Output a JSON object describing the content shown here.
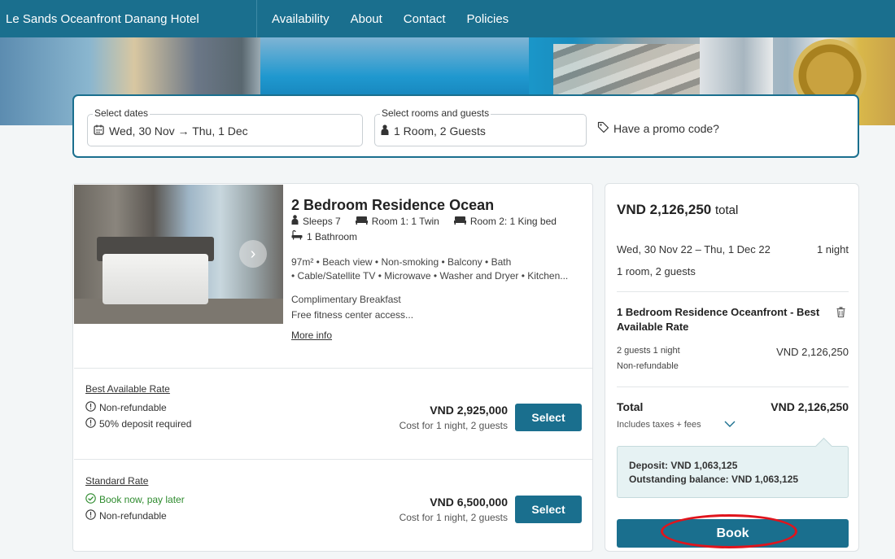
{
  "header": {
    "hotel_name": "Le Sands Oceanfront Danang Hotel",
    "nav": [
      "Availability",
      "About",
      "Contact",
      "Policies"
    ]
  },
  "search": {
    "dates_label": "Select dates",
    "dates_value": "Wed, 30 Nov → Thu, 1 Dec",
    "rooms_label": "Select rooms and guests",
    "rooms_value": "1 Room, 2 Guests",
    "promo": "Have a promo code?"
  },
  "room": {
    "title": "2 Bedroom Residence Ocean",
    "sleeps": "Sleeps 7",
    "room1": "Room 1: 1 Twin",
    "room2": "Room 2: 1 King bed",
    "bathroom": "1 Bathroom",
    "amenities_line1": "97m² • Beach view • Non-smoking • Balcony • Bath",
    "amenities_line2": "• Cable/Satellite TV • Microwave • Washer and Dryer • Kitchen...",
    "perk1": "Complimentary Breakfast",
    "perk2": "Free fitness center access...",
    "more_info": "More info",
    "rates": [
      {
        "name": "Best Available Rate",
        "items": [
          "Non-refundable",
          "50% deposit required"
        ],
        "price": "VND 2,925,000",
        "cost_note": "Cost for 1 night, 2 guests",
        "button": "Select"
      },
      {
        "name": "Standard Rate",
        "items": [
          "Book now, pay later",
          "Non-refundable"
        ],
        "price": "VND 6,500,000",
        "cost_note": "Cost for 1 night, 2 guests",
        "button": "Select"
      }
    ]
  },
  "summary": {
    "total_amount": "VND 2,126,250",
    "total_word": "total",
    "dates": "Wed, 30 Nov 22 – Thu, 1 Dec 22",
    "nights": "1 night",
    "room_guests": "1 room, 2 guests",
    "selected_room": "1 Bedroom Residence Oceanfront - Best Available Rate",
    "guests_nights": "2 guests 1 night",
    "room_price": "VND 2,126,250",
    "refund_policy": "Non-refundable",
    "total_label": "Total",
    "total_value": "VND 2,126,250",
    "taxes_note": "Includes taxes + fees",
    "deposit": "Deposit: VND 1,063,125",
    "outstanding": "Outstanding balance: VND 1,063,125",
    "book_button": "Book"
  },
  "colors": {
    "brand": "#1a6f8e",
    "highlight_ring": "#e0141c",
    "success": "#2e8b2e"
  }
}
